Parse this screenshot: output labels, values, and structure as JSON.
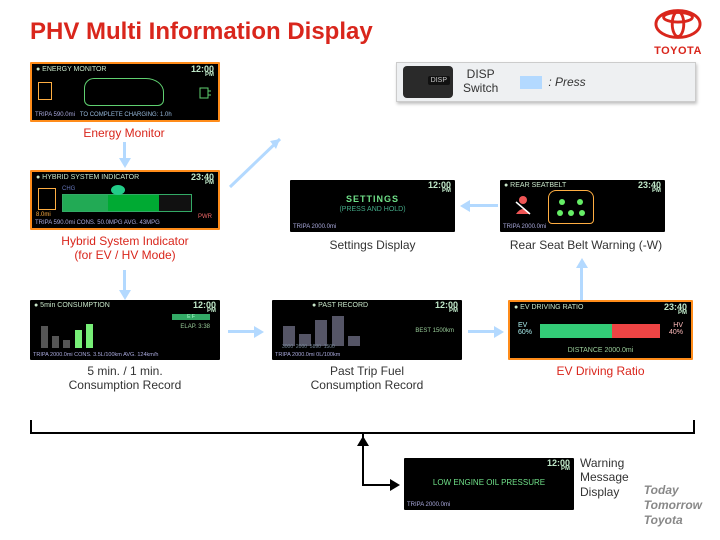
{
  "title": "PHV Multi Information Display",
  "brand": "TOYOTA",
  "footer": {
    "l1": "Today",
    "l2": "Tomorrow",
    "l3": "Toyota"
  },
  "disp": {
    "label1": "DISP",
    "label2": "Switch",
    "press": ": Press"
  },
  "captions": {
    "energy": "Energy Monitor",
    "hsi1": "Hybrid System Indicator",
    "hsi2": "(for EV / HV Mode)",
    "settings": "Settings Display",
    "rsb": "Rear Seat Belt Warning (-W)",
    "cons1": "5 min. / 1 min.",
    "cons2": "Consumption Record",
    "past1": "Past Trip Fuel",
    "past2": "Consumption Record",
    "evr": "EV Driving Ratio",
    "warn1": "Warning",
    "warn2": "Message",
    "warn3": "Display"
  },
  "screens": {
    "energy": {
      "header": "● ENERGY MONITOR",
      "clock": "12:00",
      "trip": "TRIPA 590.0mi",
      "footer": "TO COMPLETE CHARGING: 1.0h"
    },
    "hsi": {
      "header": "● HYBRID SYSTEM INDICATOR",
      "clock": "23:40",
      "ev": "8.0mi",
      "chg": "CHG",
      "pwr": "PWR",
      "trip": "TRIPA 590.0mi   CONS. 50.0MPG   AVG.  43MPG"
    },
    "settings": {
      "clock": "12:00",
      "line1": "SETTINGS",
      "line2": "(PRESS AND HOLD)",
      "trip": "TRIPA 2000.0mi"
    },
    "rsb": {
      "header": "● REAR SEATBELT",
      "clock": "23:40",
      "trip": "TRIPA 2000.0mi"
    },
    "cons": {
      "header": "● 5min CONSUMPTION",
      "clock": "12:00",
      "elap": "ELAP. 3:38",
      "trip": "TRIPA 2000.0mi   CONS. 3.5L/100km   AVG. 124km/h"
    },
    "past": {
      "header": "● PAST RECORD",
      "clock": "12:00",
      "best": "BEST 1500km",
      "trip": "TRIPA 2000.0mi   0L/100km"
    },
    "evr": {
      "header": "● EV DRIVING RATIO",
      "clock": "23:40",
      "ev": "EV\n60%",
      "hv": "HV\n40%",
      "dist": "DISTANCE  2000.0mi"
    },
    "warn": {
      "clock": "12:00",
      "msg": "LOW ENGINE OIL PRESSURE",
      "trip": "TRIPA 2000.0mi"
    }
  }
}
